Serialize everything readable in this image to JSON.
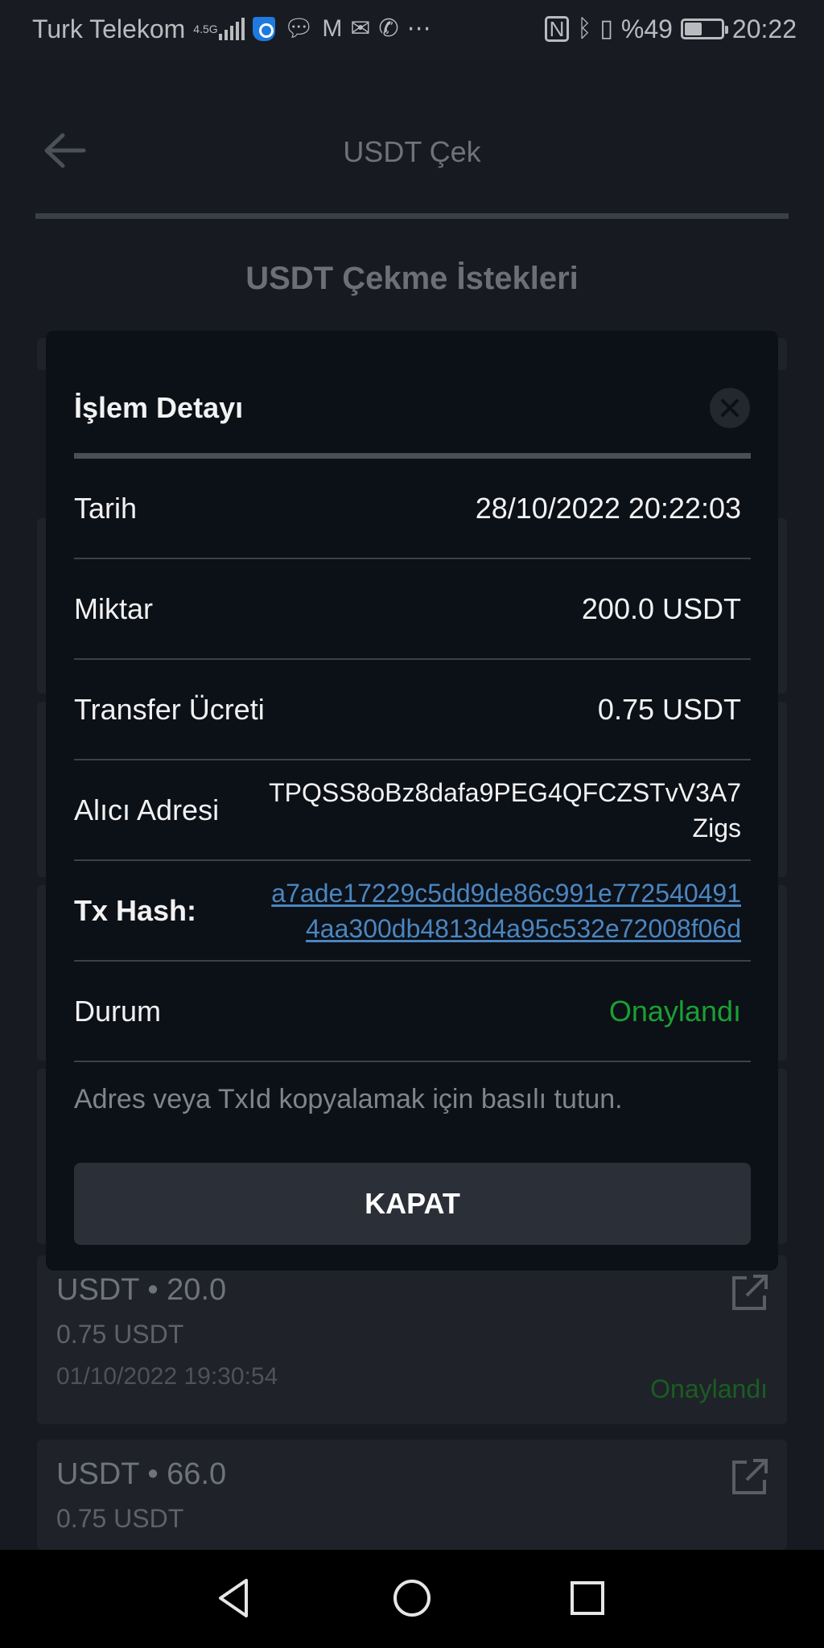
{
  "status_bar": {
    "carrier": "Turk Telekom",
    "network": "4.5G",
    "battery": "%49",
    "battery_level": 0.49,
    "time": "20:22",
    "icons": [
      "signal-icon",
      "shield-icon",
      "chat-icon",
      "gmail-icon",
      "mail-icon",
      "whatsapp-icon",
      "more-icon",
      "nfc-icon",
      "bluetooth-icon",
      "vibrate-icon",
      "battery-icon"
    ]
  },
  "header": {
    "title": "USDT Çek",
    "back_icon": "arrow-left-icon"
  },
  "section_title": "USDT Çekme İstekleri",
  "list": [
    {
      "title": "USDT • 20.0",
      "fee": "0.75 USDT",
      "date": "01/10/2022 19:30:54",
      "status": "Onaylandı"
    },
    {
      "title": "USDT • 66.0",
      "fee": "0.75 USDT"
    }
  ],
  "modal": {
    "title": "İşlem Detayı",
    "rows": [
      {
        "label": "Tarih",
        "value": "28/10/2022 20:22:03"
      },
      {
        "label": "Miktar",
        "value": "200.0 USDT"
      },
      {
        "label": "Transfer Ücreti",
        "value": "0.75 USDT"
      },
      {
        "label": "Alıcı Adresi",
        "value": "TPQSS8oBz8dafa9PEG4QFCZSTvV3A7Zigs"
      },
      {
        "label": "Tx Hash:",
        "value": "a7ade17229c5dd9de86c991e7725404914aa300db4813d4a95c532e72008f06d"
      },
      {
        "label": "Durum",
        "value": "Onaylandı"
      }
    ],
    "hint": "Adres veya TxId kopyalamak için basılı tutun.",
    "close_button": "KAPAT"
  },
  "colors": {
    "modal_bg": "#0c1017",
    "status_green": "#1aa033",
    "link_blue": "#4a86c0",
    "button_bg": "#2b2f37"
  },
  "nav": [
    "back-triangle-icon",
    "home-circle-icon",
    "recents-square-icon"
  ]
}
